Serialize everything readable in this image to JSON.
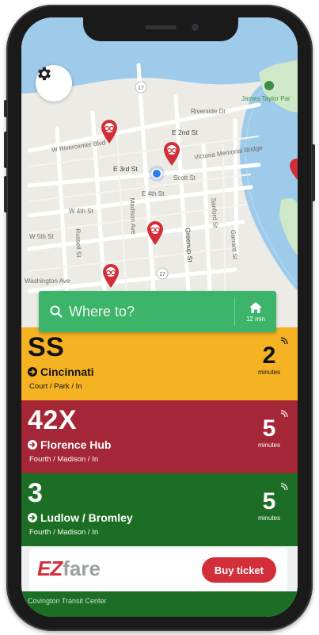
{
  "map": {
    "streets": [
      "Riverside Dr",
      "E 2nd St",
      "W Rivercenter Blvd",
      "E 3rd St",
      "Scott St",
      "E 4th St",
      "W 4th St",
      "Madison Ave",
      "Russell St",
      "W 5th St",
      "Greenup St",
      "Sanford St",
      "Garrard St",
      "Washington Ave",
      "Victoria Memorial Bridge",
      "James Taylor Par",
      "17"
    ],
    "icons": [
      "gear-icon",
      "bike-share-marker",
      "current-location-dot"
    ]
  },
  "search": {
    "placeholder": "Where to?",
    "home_time": "12 min"
  },
  "arrivals": [
    {
      "route": "SS",
      "destination": "Cincinnati",
      "stop": "Court / Park / In",
      "minutes": "2",
      "minutes_label": "minutes",
      "bg": "#f5b323",
      "fg": "#111111"
    },
    {
      "route": "42X",
      "destination": "Florence Hub",
      "stop": "Fourth / Madison / In",
      "minutes": "5",
      "minutes_label": "minutes",
      "bg": "#a52637",
      "fg": "#ffffff"
    },
    {
      "route": "3",
      "destination": "Ludlow / Bromley",
      "stop": "Fourth / Madison / In",
      "minutes": "5",
      "minutes_label": "minutes",
      "bg": "#1b6e23",
      "fg": "#ffffff"
    }
  ],
  "ezfare": {
    "logo_ez": "EZ",
    "logo_fare": "fare",
    "buy_label": "Buy ticket"
  },
  "footer_stop": "Covington Transit Center",
  "colors": {
    "accent_green": "#3cb46a",
    "river": "#9ecbea",
    "buy_red": "#d32f3a"
  }
}
